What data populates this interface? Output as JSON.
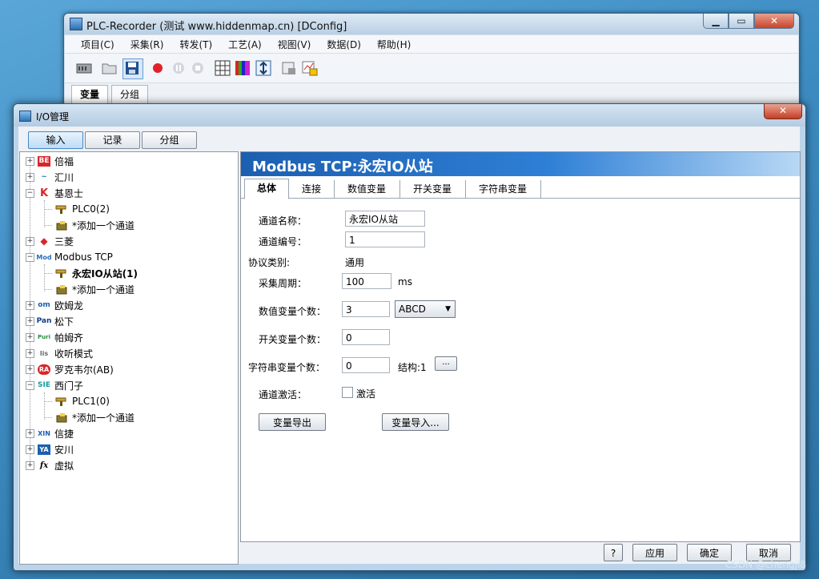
{
  "main_window": {
    "title": "PLC-Recorder (测试 www.hiddenmap.cn) [DConfig]",
    "menu": [
      "项目(C)",
      "采集(R)",
      "转发(T)",
      "工艺(A)",
      "视图(V)",
      "数据(D)",
      "帮助(H)"
    ],
    "tabs": [
      "变量",
      "分组"
    ],
    "caption_min": "▁",
    "caption_max": "▭",
    "caption_close": "✕"
  },
  "dialog": {
    "title": "I/O管理",
    "close": "✕",
    "top_buttons": [
      "输入",
      "记录",
      "分组"
    ],
    "tree": [
      {
        "label": "倍福",
        "icon": "BE",
        "expander": "+"
      },
      {
        "label": "汇川",
        "icon": "~",
        "expander": "+"
      },
      {
        "label": "基恩士",
        "icon": "K",
        "expander": "−"
      },
      {
        "label": "PLC0(2)",
        "icon": "plc-icon",
        "expander": ""
      },
      {
        "label": "*添加一个通道",
        "icon": "add-icon",
        "expander": ""
      },
      {
        "label": "三菱",
        "icon": "◆",
        "expander": "+"
      },
      {
        "label": "Modbus TCP",
        "icon": "Mod",
        "expander": "−"
      },
      {
        "label": "永宏IO从站(1)",
        "icon": "plc-icon",
        "expander": ""
      },
      {
        "label": "*添加一个通道",
        "icon": "add-icon",
        "expander": ""
      },
      {
        "label": "欧姆龙",
        "icon": "om",
        "expander": "+"
      },
      {
        "label": "松下",
        "icon": "Pan",
        "expander": "+"
      },
      {
        "label": "帕姆齐",
        "icon": "Puri",
        "expander": "+"
      },
      {
        "label": "收听模式",
        "icon": "lis",
        "expander": "+"
      },
      {
        "label": "罗克韦尔(AB)",
        "icon": "RA",
        "expander": "+"
      },
      {
        "label": "西门子",
        "icon": "SIE",
        "expander": "−"
      },
      {
        "label": "PLC1(0)",
        "icon": "plc-icon",
        "expander": ""
      },
      {
        "label": "*添加一个通道",
        "icon": "add-icon",
        "expander": ""
      },
      {
        "label": "信捷",
        "icon": "XIN",
        "expander": "+"
      },
      {
        "label": "安川",
        "icon": "YA",
        "expander": "+"
      },
      {
        "label": "虚拟",
        "icon": "fx",
        "expander": "+"
      }
    ],
    "panel": {
      "header": "Modbus TCP:永宏IO从站",
      "tabs": [
        "总体",
        "连接",
        "数值变量",
        "开关变量",
        "字符串变量"
      ],
      "fields": {
        "channel_name_label": "通道名称：",
        "channel_name": "永宏IO从站",
        "channel_no_label": "通道编号：",
        "channel_no": "1",
        "protocol_label": "协议类别:",
        "protocol": "通用",
        "period_label": "采集周期：",
        "period": "100",
        "period_unit": "ms",
        "num_var_label": "数值变量个数：",
        "num_var": "3",
        "byte_order": "ABCD",
        "switch_var_label": "开关变量个数：",
        "switch_var": "0",
        "string_var_label": "字符串变量个数：",
        "string_var": "0",
        "struct_label": "结构:1",
        "struct_btn": "...",
        "activate_label": "通道激活：",
        "activate_text": "激活",
        "export_btn": "变量导出",
        "import_btn": "变量导入..."
      }
    },
    "bottom_buttons": {
      "help": "?",
      "apply": "应用",
      "ok": "确定",
      "cancel": "取消"
    }
  },
  "watermark": "CSDN @chengjl8"
}
